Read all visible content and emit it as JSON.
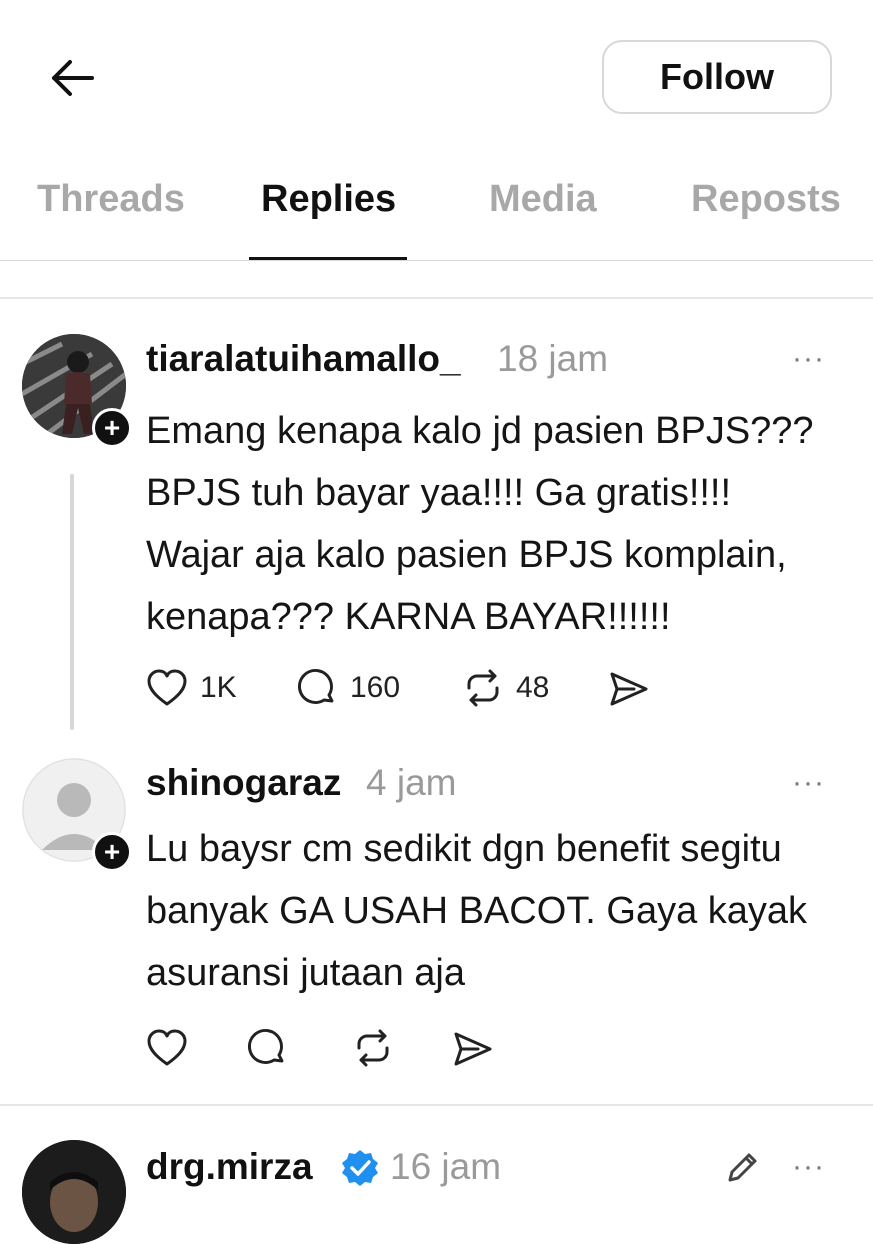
{
  "header": {
    "back_icon": "arrow-left-icon",
    "follow_label": "Follow"
  },
  "tabs": [
    {
      "label": "Threads",
      "active": false
    },
    {
      "label": "Replies",
      "active": true
    },
    {
      "label": "Media",
      "active": false
    },
    {
      "label": "Reposts",
      "active": false
    }
  ],
  "posts": [
    {
      "username": "tiaralatuihamallo_",
      "time": "18 jam",
      "lines": [
        "Emang kenapa kalo jd pasien BPJS???",
        "BPJS tuh bayar yaa!!!! Ga gratis!!!!",
        "Wajar aja kalo pasien BPJS komplain,",
        "kenapa??? KARNA BAYAR!!!!!!"
      ],
      "likes": "1K",
      "replies": "160",
      "reposts": "48"
    },
    {
      "username": "shinogaraz",
      "time": "4 jam",
      "lines": [
        "Lu baysr cm sedikit dgn benefit segitu",
        "banyak GA USAH BACOT. Gaya kayak",
        "asuransi jutaan aja"
      ]
    },
    {
      "username": "drg.mirza",
      "time": "16 jam",
      "verified": true
    }
  ],
  "more_label": "···",
  "plus_label": "+",
  "colors": {
    "text": "#111111",
    "muted": "#9a9a9a",
    "tab_inactive": "#a8a8a8",
    "verified": "#1f8ff0"
  }
}
